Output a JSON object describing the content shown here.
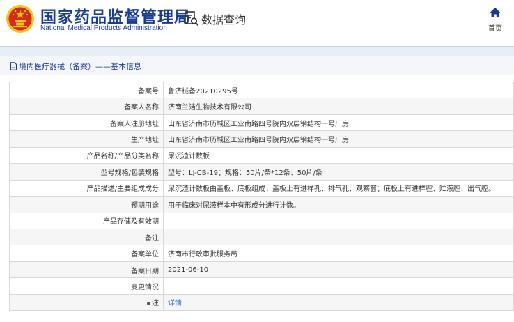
{
  "header": {
    "title_cn": "国家药品监督管理局",
    "title_en": "National Medical Products Administration",
    "query_label": "数据查询",
    "home_label": "首页"
  },
  "breadcrumb": {
    "text": "境内医疗器械（备案）——基本信息"
  },
  "colors": {
    "brand_blue": "#1a3c8e",
    "emblem_red": "#d62a1e",
    "emblem_gold": "#f2c318",
    "link_blue": "#2f6fd0"
  },
  "record": {
    "rows": [
      {
        "label": "备案号",
        "value": "鲁济械备20210295号"
      },
      {
        "label": "备案人名称",
        "value": "济南兰洁生物技术有限公司"
      },
      {
        "label": "备案人注册地址",
        "value": "山东省济南市历城区工业南路四号院内双层钢结构一号厂房"
      },
      {
        "label": "生产地址",
        "value": "山东省济南市历城区工业南路四号院内双层钢结构一号厂房"
      },
      {
        "label": "产品名称/产品分类名称",
        "value": "尿沉渣计数板"
      },
      {
        "label": "型号规格/包装规格",
        "value": "型号：LJ-CB-19；规格：50片/条*12条、50片/条"
      },
      {
        "label": "产品描述/主要组成成分",
        "value": "尿沉渣计数板由盖板、底板组成；盖板上有进样孔、排气孔、观察窗；底板上有进样腔、贮液腔、出气腔。"
      },
      {
        "label": "预期用途",
        "value": "用于临床对尿液样本中有形成分进行计数。"
      },
      {
        "label": "产品存储及有效期",
        "value": ""
      },
      {
        "label": "备注",
        "value": ""
      },
      {
        "label": "备案单位",
        "value": "济南市行政审批服务局"
      },
      {
        "label": "备案日期",
        "value": "2021-06-10"
      },
      {
        "label": "变更情况",
        "value": ""
      },
      {
        "label": "注",
        "value": "详情"
      }
    ]
  }
}
